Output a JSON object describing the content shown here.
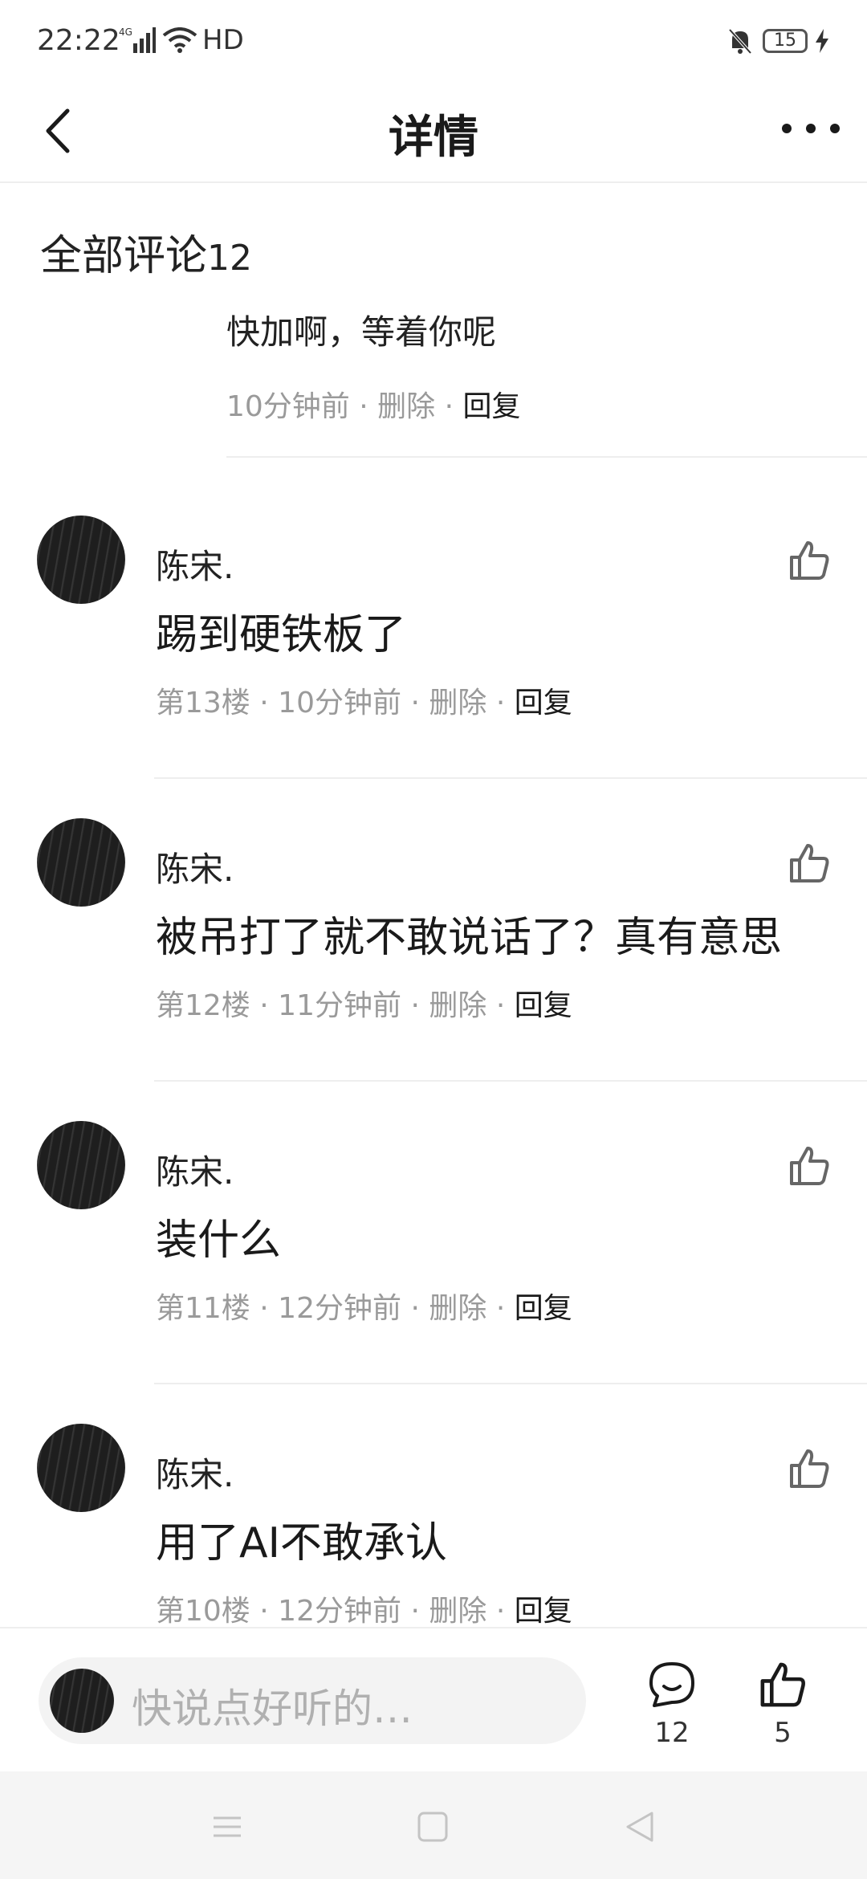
{
  "status": {
    "time": "22:22",
    "network": "HD",
    "battery": "15"
  },
  "nav": {
    "title": "详情"
  },
  "section": {
    "title": "全部评论",
    "count": "12"
  },
  "top_reply": {
    "text": "快加啊，等着你呢",
    "time": "10分钟前",
    "delete": "删除",
    "reply": "回复"
  },
  "comments": [
    {
      "author": "陈宋.",
      "text": "踢到硬铁板了",
      "floor": "第13楼",
      "time": "10分钟前",
      "delete": "删除",
      "reply": "回复"
    },
    {
      "author": "陈宋.",
      "text": "被吊打了就不敢说话了？真有意思",
      "floor": "第12楼",
      "time": "11分钟前",
      "delete": "删除",
      "reply": "回复"
    },
    {
      "author": "陈宋.",
      "text": "装什么",
      "floor": "第11楼",
      "time": "12分钟前",
      "delete": "删除",
      "reply": "回复"
    },
    {
      "author": "陈宋.",
      "text": "用了AI不敢承认",
      "floor": "第10楼",
      "time": "12分钟前",
      "delete": "删除",
      "reply": "回复"
    }
  ],
  "bottom": {
    "placeholder": "快说点好听的…",
    "comment_count": "12",
    "like_count": "5"
  },
  "separator": "·",
  "icons": {
    "back": "back-arrow-icon",
    "more": "more-dots-icon",
    "like": "thumbs-up-icon",
    "comment": "comment-bubble-icon"
  }
}
